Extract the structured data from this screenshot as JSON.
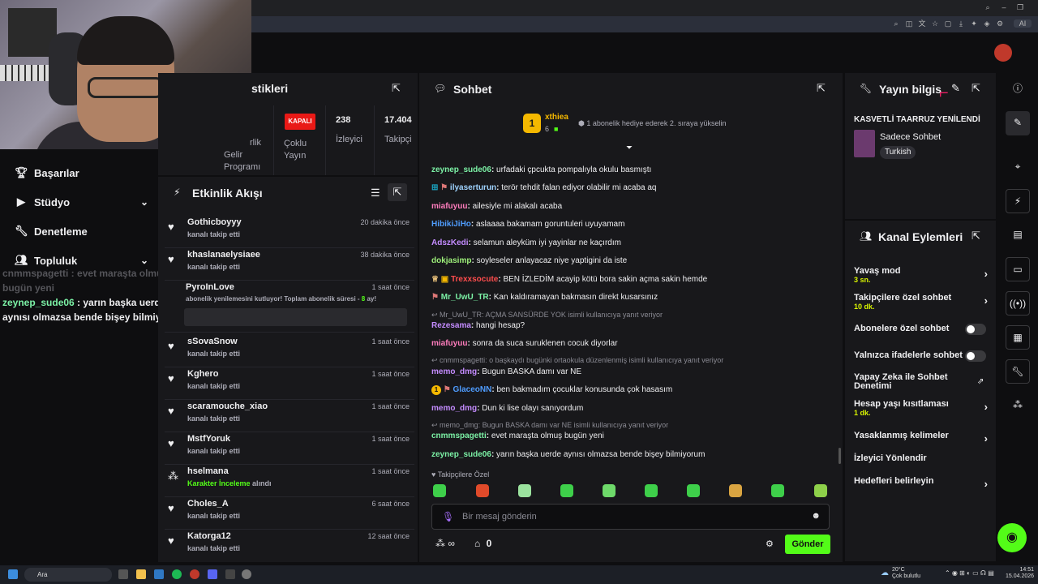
{
  "stats": {
    "title_partial": "stikleri",
    "col1_partial": [
      "rlik"
    ],
    "col1b": [
      "Gelir",
      "Programı"
    ],
    "kapali_badge": "KAPALI",
    "multi_stream": [
      "Çoklu",
      "Yayın"
    ],
    "viewers_value": "238",
    "viewers_label": "İzleyici",
    "followers_value": "17.404",
    "followers_label_partial": "Takipçi"
  },
  "left_menu": {
    "items": [
      {
        "label": "Başarılar",
        "icon": "trophy-icon"
      },
      {
        "label": "Stüdyo",
        "icon": "video-icon"
      },
      {
        "label": "Denetleme",
        "icon": "wrench-icon"
      },
      {
        "label": "Topluluk",
        "icon": "people-icon"
      }
    ]
  },
  "overlay_chat": {
    "ghost": "cnmmspagetti : evet maraşta olmuş bugün yeni",
    "user": "zeynep_sude06",
    "msg": " : yarın başka uerde aynısı olmazsa bende bişey bilmiyorum"
  },
  "activity": {
    "title": "Etkinlik Akışı",
    "items": [
      {
        "name": "Gothicboyyy",
        "sub": "kanalı takip etti",
        "time": "20 dakika önce"
      },
      {
        "name": "khaslanaelysiaee",
        "sub": "kanalı takip etti",
        "time": "38 dakika önce"
      },
      {
        "name": "PyroInLove",
        "sub": "abonelik yenilemesini kutluyor! Toplam abonelik süresi - ",
        "sub_hl": "8",
        "sub_tail": " ay!",
        "time": "1 saat önce"
      },
      {
        "name": "sSovaSnow",
        "sub": "kanalı takip etti",
        "time": "1 saat önce"
      },
      {
        "name": "Kghero",
        "sub": "kanalı takip etti",
        "time": "1 saat önce"
      },
      {
        "name": "scaramouche_xiao",
        "sub": "kanalı takip etti",
        "time": "1 saat önce"
      },
      {
        "name": "MstfYoruk",
        "sub": "kanalı takip etti",
        "time": "1 saat önce"
      },
      {
        "name": "hselmana",
        "sub_hl": "Karakter İnceleme",
        "sub_tail": " alındı",
        "time": "1 saat önce"
      },
      {
        "name": "Choles_A",
        "sub": "kanalı takip etti",
        "time": "6 saat önce"
      },
      {
        "name": "Katorga12",
        "sub": "kanalı takip etti",
        "time": "12 saat önce"
      }
    ]
  },
  "chat": {
    "title": "Sohbet",
    "pinned_user": "xthiea",
    "pinned_rank": "1",
    "pinned_count": "6",
    "pinned_msg": "1 abonelik hediye ederek 2. sıraya yükselin",
    "lines": [
      {
        "user": "zeynep_sude06",
        "color": "#7cf2a6",
        "msg": "urfadaki çpcukta pompalıyla okulu basmıştı"
      },
      {
        "user": "ilyaserturun",
        "color": "#9fd3ff",
        "msg": "terör tehdit falan ediyor olabilir mi acaba aq"
      },
      {
        "user": "miafuyuu",
        "color": "#ff7dbd",
        "msg": "ailesiyle mi alakalı acaba"
      },
      {
        "user": "HibikiJiHo",
        "color": "#4f9dff",
        "msg": "aslaaaa bakamam goruntuleri uyuyamam"
      },
      {
        "user": "AdszKedi",
        "color": "#c48cff",
        "msg": "selamun aleyküm iyi yayinlar ne kaçırdım"
      },
      {
        "user": "dokjasimp",
        "color": "#9ef07a",
        "msg": "soyleseler anlayacaz niye yaptigini da iste"
      },
      {
        "user": "Trexxsocute",
        "color": "#ff4d4d",
        "msg": "BEN İZLEDİM acayip kötü bora sakin açma sakin hemde"
      },
      {
        "user": "Mr_UwU_TR",
        "color": "#7cf2a6",
        "msg": "Kan kaldıramayan bakmasın direkt kusarsınız"
      },
      {
        "reply": "Mr_UwU_TR: AÇMA SANSÜRDE YOK isimli kullanıcıya yanıt veriyor"
      },
      {
        "user": "Rezesama",
        "color": "#c48cff",
        "msg": "hangi hesap?"
      },
      {
        "user": "miafuyuu",
        "color": "#ff7dbd",
        "msg": "sonra da suca suruklenen cocuk diyorlar"
      },
      {
        "reply": "cnmmspagetti: o başkaydı bugünki ortaokula düzenlenmiş isimli kullanıcıya yanıt veriyor"
      },
      {
        "user": "memo_dmg",
        "color": "#c48cff",
        "msg": "Bugun BASKA damı var NE"
      },
      {
        "user": "GlaceoNN",
        "color": "#4f9dff",
        "msg": "ben bakmadım çocuklar konusunda çok hasasım"
      },
      {
        "user": "memo_dmg",
        "color": "#c48cff",
        "msg": "Dun ki lise olayı sanıyordum"
      },
      {
        "reply": "memo_dmg: Bugun BASKA damı var NE isimli kullanıcıya yanıt veriyor"
      },
      {
        "user": "cnmmspagetti",
        "color": "#7cf2a6",
        "msg": "evet maraşta olmuş bugün yeni"
      },
      {
        "user": "zeynep_sude06",
        "color": "#7cf2a6",
        "msg": "yarın başka uerde aynısı olmazsa bende bişey bilmiyorum"
      }
    ],
    "followers_only": "Takipçilere Özel",
    "input_placeholder": "Bir mesaj gönderin",
    "points": "∞",
    "store_count": "0",
    "send": "Gönder"
  },
  "info": {
    "title_partial": "Yayın bilgis",
    "stream_title": "KASVETLİ TAARRUZ YENİLENDİ",
    "category": "Sadece Sohbet",
    "tag": "Turkish"
  },
  "actions": {
    "title": "Kanal Eylemleri",
    "items": [
      {
        "label": "Yavaş mod",
        "sub": "3 sn.",
        "kind": "chev"
      },
      {
        "label": "Takipçilere özel sohbet",
        "sub": "10 dk.",
        "kind": "chev"
      },
      {
        "label": "Abonelere özel sohbet",
        "kind": "toggle"
      },
      {
        "label": "Yalnızca ifadelerle sohbet",
        "kind": "toggle"
      },
      {
        "label": "Yapay Zeka ile Sohbet Denetimi",
        "kind": "ext"
      },
      {
        "label": "Hesap yaşı kısıtlaması",
        "sub": "1 dk.",
        "kind": "chev"
      },
      {
        "label": "Yasaklanmış kelimeler",
        "kind": "chev"
      },
      {
        "label": "İzleyici Yönlendir",
        "kind": "none"
      },
      {
        "label": "Hedefleri belirleyin",
        "kind": "chev"
      }
    ]
  },
  "taskbar": {
    "search": "Ara",
    "weather_temp": "20°C",
    "weather_desc": "Çok bulutlu",
    "time": "14:51",
    "date": "15.04.2026"
  },
  "colors": {
    "accent": "#53fc18",
    "badge_red": "#e91916",
    "bg": "#0e0e10",
    "panel": "#18181b"
  }
}
